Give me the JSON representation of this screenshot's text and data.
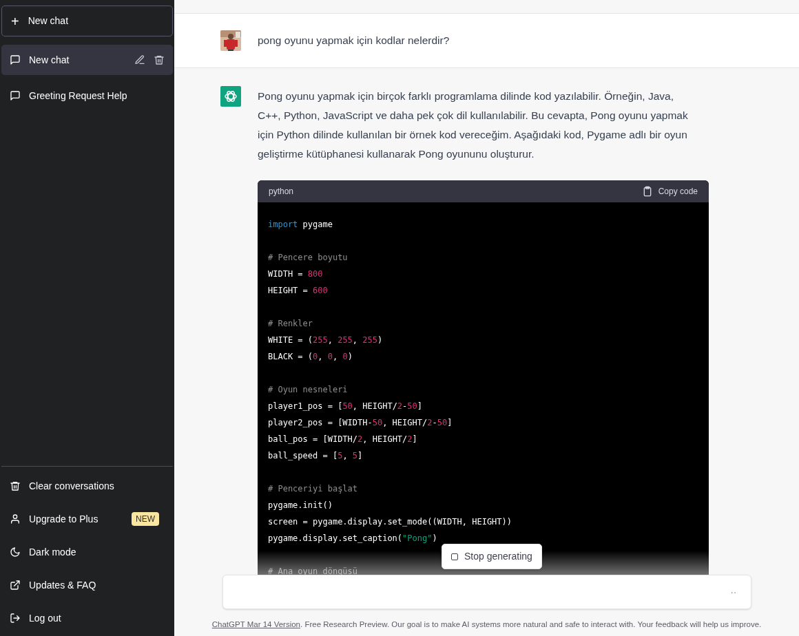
{
  "sidebar": {
    "new_chat": {
      "icon": "+",
      "label": "New chat"
    },
    "conversations": [
      {
        "title": "New chat",
        "selected": true
      },
      {
        "title": "Greeting Request Help",
        "selected": false
      }
    ],
    "menu": [
      {
        "kind": "trash",
        "label": "Clear conversations"
      },
      {
        "kind": "user",
        "label": "Upgrade to Plus",
        "badge": "NEW"
      },
      {
        "kind": "moon",
        "label": "Dark mode"
      },
      {
        "kind": "external",
        "label": "Updates & FAQ"
      },
      {
        "kind": "logout",
        "label": "Log out"
      }
    ]
  },
  "messages": [
    {
      "kind": "user",
      "text": "pong oyunu yapmak için kodlar nelerdir?"
    },
    {
      "kind": "assistant",
      "text": "Pong oyunu yapmak için birçok farklı programlama dilinde kod yazılabilir. Örneğin, Java, C++, Python, JavaScript ve daha pek çok dil kullanılabilir. Bu cevapta, Pong oyunu yapmak için Python dilinde kullanılan bir örnek kod vereceğim. Aşağıdaki kod, Pygame adlı bir oyun geliştirme kütüphanesi kullanarak Pong oyununu oluşturur.",
      "code": {
        "language": "python",
        "copy_label": "Copy code",
        "paragraphs": [
          {
            "lines": [
              [
                {
                  "kind": "keyword",
                  "text": "import"
                },
                {
                  "kind": "plain",
                  "text": " pygame"
                }
              ]
            ]
          },
          {
            "lines": [
              [
                {
                  "kind": "comment",
                  "text": "# Pencere boyutu"
                }
              ],
              [
                {
                  "kind": "plain",
                  "text": "WIDTH = "
                },
                {
                  "kind": "number",
                  "text": "800"
                }
              ],
              [
                {
                  "kind": "plain",
                  "text": "HEIGHT = "
                },
                {
                  "kind": "number",
                  "text": "600"
                }
              ]
            ]
          },
          {
            "lines": [
              [
                {
                  "kind": "comment",
                  "text": "# Renkler"
                }
              ],
              [
                {
                  "kind": "plain",
                  "text": "WHITE = ("
                },
                {
                  "kind": "number",
                  "text": "255"
                },
                {
                  "kind": "plain",
                  "text": ", "
                },
                {
                  "kind": "number",
                  "text": "255"
                },
                {
                  "kind": "plain",
                  "text": ", "
                },
                {
                  "kind": "number",
                  "text": "255"
                },
                {
                  "kind": "plain",
                  "text": ")"
                }
              ],
              [
                {
                  "kind": "plain",
                  "text": "BLACK = ("
                },
                {
                  "kind": "number",
                  "text": "0"
                },
                {
                  "kind": "plain",
                  "text": ", "
                },
                {
                  "kind": "number",
                  "text": "0"
                },
                {
                  "kind": "plain",
                  "text": ", "
                },
                {
                  "kind": "number",
                  "text": "0"
                },
                {
                  "kind": "plain",
                  "text": ")"
                }
              ]
            ]
          },
          {
            "lines": [
              [
                {
                  "kind": "comment",
                  "text": "# Oyun nesneleri"
                }
              ],
              [
                {
                  "kind": "plain",
                  "text": "player1_pos = ["
                },
                {
                  "kind": "number",
                  "text": "50"
                },
                {
                  "kind": "plain",
                  "text": ", HEIGHT/"
                },
                {
                  "kind": "number",
                  "text": "2"
                },
                {
                  "kind": "plain",
                  "text": "-"
                },
                {
                  "kind": "number",
                  "text": "50"
                },
                {
                  "kind": "plain",
                  "text": "]"
                }
              ],
              [
                {
                  "kind": "plain",
                  "text": "player2_pos = [WIDTH-"
                },
                {
                  "kind": "number",
                  "text": "50"
                },
                {
                  "kind": "plain",
                  "text": ", HEIGHT/"
                },
                {
                  "kind": "number",
                  "text": "2"
                },
                {
                  "kind": "plain",
                  "text": "-"
                },
                {
                  "kind": "number",
                  "text": "50"
                },
                {
                  "kind": "plain",
                  "text": "]"
                }
              ],
              [
                {
                  "kind": "plain",
                  "text": "ball_pos = [WIDTH/"
                },
                {
                  "kind": "number",
                  "text": "2"
                },
                {
                  "kind": "plain",
                  "text": ", HEIGHT/"
                },
                {
                  "kind": "number",
                  "text": "2"
                },
                {
                  "kind": "plain",
                  "text": "]"
                }
              ],
              [
                {
                  "kind": "plain",
                  "text": "ball_speed = ["
                },
                {
                  "kind": "number",
                  "text": "5"
                },
                {
                  "kind": "plain",
                  "text": ", "
                },
                {
                  "kind": "number",
                  "text": "5"
                },
                {
                  "kind": "plain",
                  "text": "]"
                }
              ]
            ]
          },
          {
            "lines": [
              [
                {
                  "kind": "comment",
                  "text": "# Penceriyi başlat"
                }
              ],
              [
                {
                  "kind": "plain",
                  "text": "pygame.init()"
                }
              ],
              [
                {
                  "kind": "plain",
                  "text": "screen = pygame.display.set_mode((WIDTH, HEIGHT))"
                }
              ],
              [
                {
                  "kind": "plain",
                  "text": "pygame.display.set_caption("
                },
                {
                  "kind": "string",
                  "text": "\"Pong\""
                },
                {
                  "kind": "plain",
                  "text": ")"
                }
              ]
            ]
          },
          {
            "lines": [
              [
                {
                  "kind": "comment",
                  "text": "# Ana oyun döngüsü"
                }
              ]
            ]
          }
        ]
      }
    }
  ],
  "stop_button": {
    "label": "Stop generating"
  },
  "composer": {
    "indicator": "··"
  },
  "footer": {
    "link": "ChatGPT Mar 14 Version",
    "text": ". Free Research Preview. Our goal is to make AI systems more natural and safe to interact with. Your feedback will help us improve."
  }
}
